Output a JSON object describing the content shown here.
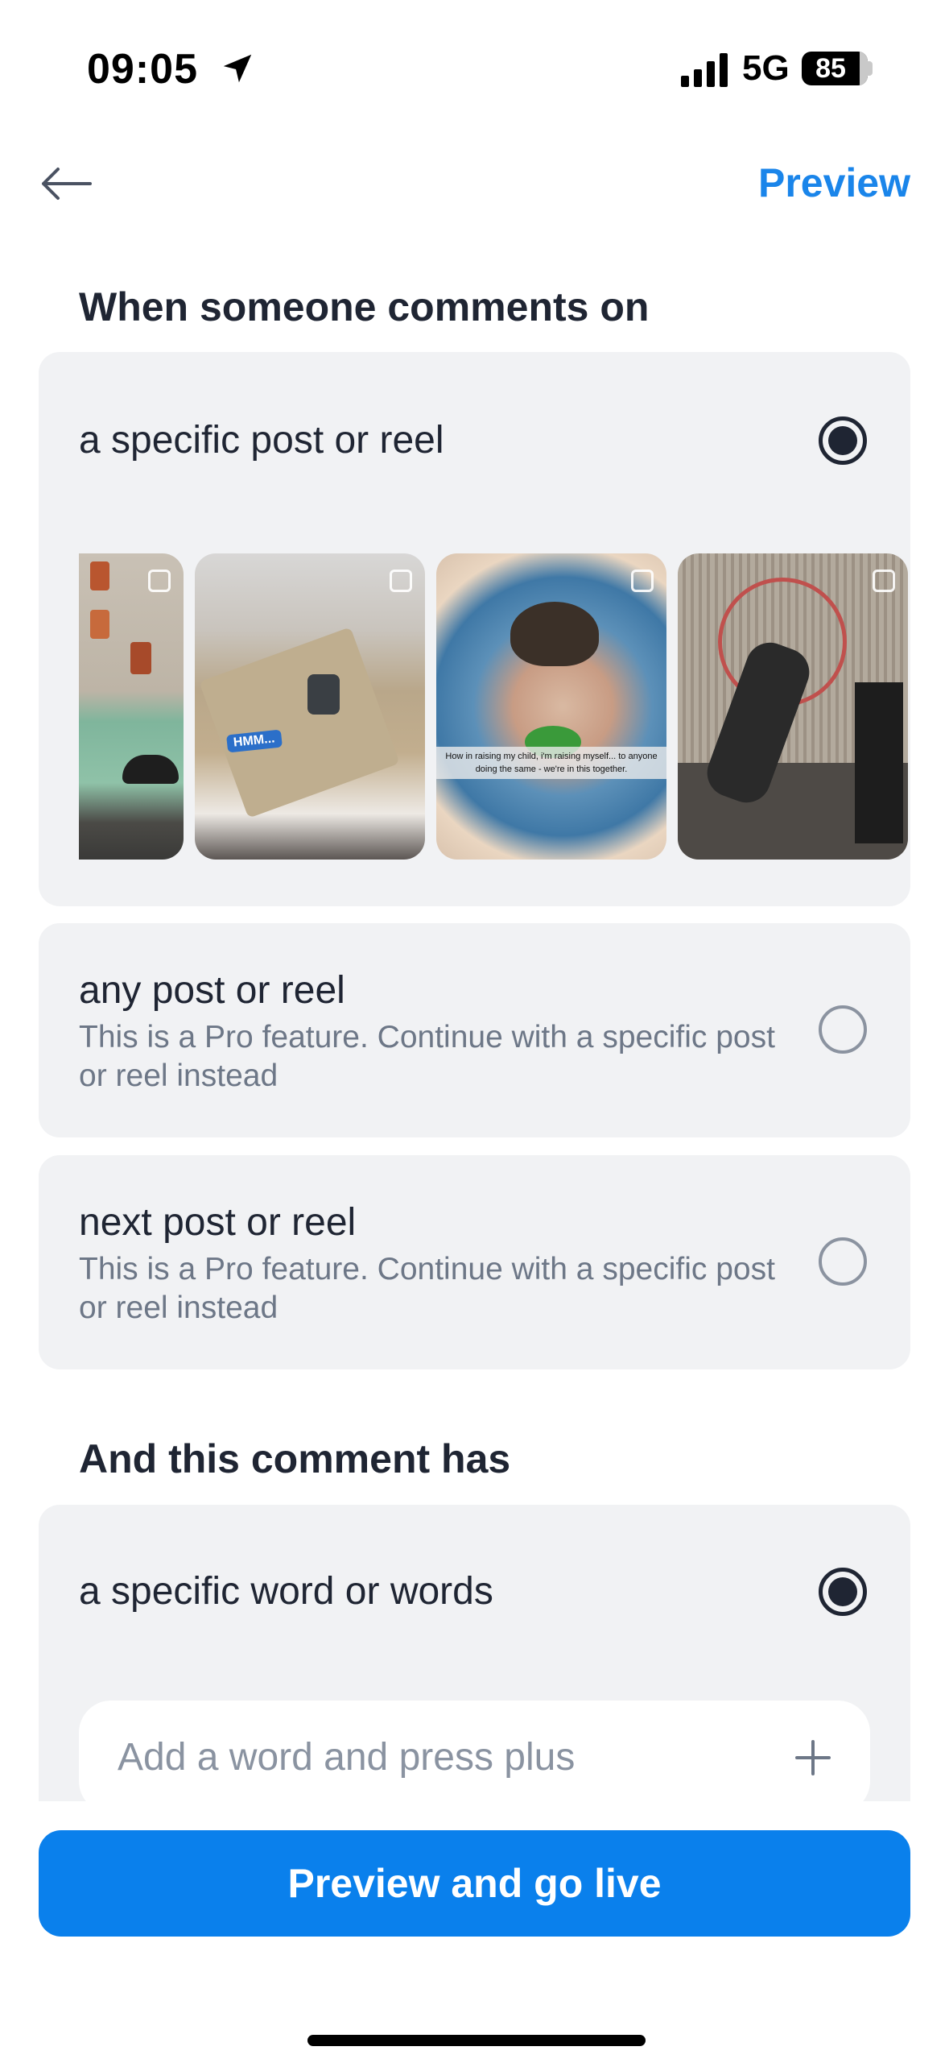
{
  "status_bar": {
    "time": "09:05",
    "network": "5G",
    "battery": "85"
  },
  "header": {
    "back_icon": "arrow-left-icon",
    "preview_label": "Preview"
  },
  "trigger_section": {
    "title": "When someone comments on",
    "options": [
      {
        "label": "a specific post or reel",
        "selected": true
      },
      {
        "label": "any post or reel",
        "subtitle": "This is a Pro feature. Continue with a specific post or reel instead",
        "selected": false
      },
      {
        "label": "next post or reel",
        "subtitle": "This is a Pro feature. Continue with a specific post or reel instead",
        "selected": false
      }
    ],
    "thumbnails": [
      {
        "type": "reel",
        "icon": "reel-icon"
      },
      {
        "type": "reel",
        "icon": "reel-icon",
        "sticker": "HMM..."
      },
      {
        "type": "carousel",
        "icon": "carousel-icon",
        "caption": "How in raising my child, i'm raising myself... to anyone doing the same - we're in this together."
      },
      {
        "type": "reel",
        "icon": "reel-icon"
      }
    ]
  },
  "comment_section": {
    "title": "And this comment has",
    "option": {
      "label": "a specific word or words",
      "selected": true
    },
    "input_placeholder": "Add a word and press plus",
    "add_icon": "plus-icon"
  },
  "cta": {
    "label": "Preview and go live"
  }
}
